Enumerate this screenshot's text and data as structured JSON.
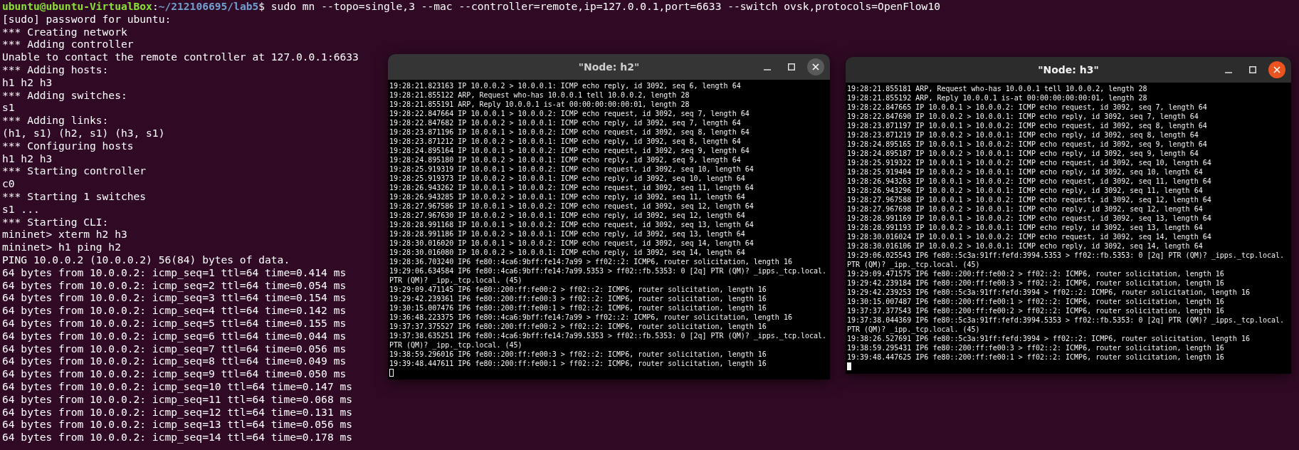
{
  "terminal": {
    "prompt": {
      "user_host": "ubuntu@ubuntu-VirtualBox",
      "separator": ":",
      "path": "~/212106695/lab5",
      "command": "$ sudo mn --topo=single,3 --mac --controller=remote,ip=127.0.0.1,port=6633 --switch ovsk,protocols=OpenFlow10"
    },
    "lines": [
      "[sudo] password for ubuntu:",
      "*** Creating network",
      "*** Adding controller",
      "Unable to contact the remote controller at 127.0.0.1:6633",
      "*** Adding hosts:",
      "h1 h2 h3",
      "*** Adding switches:",
      "s1",
      "*** Adding links:",
      "(h1, s1) (h2, s1) (h3, s1)",
      "*** Configuring hosts",
      "h1 h2 h3",
      "*** Starting controller",
      "c0",
      "*** Starting 1 switches",
      "s1 ...",
      "*** Starting CLI:",
      "mininet> xterm h2 h3",
      "mininet> h1 ping h2",
      "PING 10.0.0.2 (10.0.0.2) 56(84) bytes of data.",
      "64 bytes from 10.0.0.2: icmp_seq=1 ttl=64 time=0.414 ms",
      "64 bytes from 10.0.0.2: icmp_seq=2 ttl=64 time=0.054 ms",
      "64 bytes from 10.0.0.2: icmp_seq=3 ttl=64 time=0.154 ms",
      "64 bytes from 10.0.0.2: icmp_seq=4 ttl=64 time=0.142 ms",
      "64 bytes from 10.0.0.2: icmp_seq=5 ttl=64 time=0.155 ms",
      "64 bytes from 10.0.0.2: icmp_seq=6 ttl=64 time=0.044 ms",
      "64 bytes from 10.0.0.2: icmp_seq=7 ttl=64 time=0.056 ms",
      "64 bytes from 10.0.0.2: icmp_seq=8 ttl=64 time=0.049 ms",
      "64 bytes from 10.0.0.2: icmp_seq=9 ttl=64 time=0.050 ms",
      "64 bytes from 10.0.0.2: icmp_seq=10 ttl=64 time=0.147 ms",
      "64 bytes from 10.0.0.2: icmp_seq=11 ttl=64 time=0.068 ms",
      "64 bytes from 10.0.0.2: icmp_seq=12 ttl=64 time=0.131 ms",
      "64 bytes from 10.0.0.2: icmp_seq=13 ttl=64 time=0.056 ms",
      "64 bytes from 10.0.0.2: icmp_seq=14 ttl=64 time=0.178 ms"
    ]
  },
  "windows": [
    {
      "title": "\"Node: h2\"",
      "focused": false,
      "lines": [
        "19:28:21.823163 IP 10.0.0.2 > 10.0.0.1: ICMP echo reply, id 3092, seq 6, length 64",
        "19:28:21.855122 ARP, Request who-has 10.0.0.1 tell 10.0.0.2, length 28",
        "19:28:21.855191 ARP, Reply 10.0.0.1 is-at 00:00:00:00:00:01, length 28",
        "19:28:22.847664 IP 10.0.0.1 > 10.0.0.2: ICMP echo request, id 3092, seq 7, length 64",
        "19:28:22.847682 IP 10.0.0.2 > 10.0.0.1: ICMP echo reply, id 3092, seq 7, length 64",
        "19:28:23.871196 IP 10.0.0.1 > 10.0.0.2: ICMP echo request, id 3092, seq 8, length 64",
        "19:28:23.871212 IP 10.0.0.2 > 10.0.0.1: ICMP echo reply, id 3092, seq 8, length 64",
        "19:28:24.895164 IP 10.0.0.1 > 10.0.0.2: ICMP echo request, id 3092, seq 9, length 64",
        "19:28:24.895180 IP 10.0.0.2 > 10.0.0.1: ICMP echo reply, id 3092, seq 9, length 64",
        "19:28:25.919319 IP 10.0.0.1 > 10.0.0.2: ICMP echo request, id 3092, seq 10, length 64",
        "19:28:25.919373 IP 10.0.0.2 > 10.0.0.1: ICMP echo reply, id 3092, seq 10, length 64",
        "19:28:26.943262 IP 10.0.0.1 > 10.0.0.2: ICMP echo request, id 3092, seq 11, length 64",
        "19:28:26.943285 IP 10.0.0.2 > 10.0.0.1: ICMP echo reply, id 3092, seq 11, length 64",
        "19:28:27.967586 IP 10.0.0.1 > 10.0.0.2: ICMP echo request, id 3092, seq 12, length 64",
        "19:28:27.967630 IP 10.0.0.2 > 10.0.0.1: ICMP echo reply, id 3092, seq 12, length 64",
        "19:28:28.991168 IP 10.0.0.1 > 10.0.0.2: ICMP echo request, id 3092, seq 13, length 64",
        "19:28:28.991186 IP 10.0.0.2 > 10.0.0.1: ICMP echo reply, id 3092, seq 13, length 64",
        "19:28:30.016020 IP 10.0.0.1 > 10.0.0.2: ICMP echo request, id 3092, seq 14, length 64",
        "19:28:30.016080 IP 10.0.0.2 > 10.0.0.1: ICMP echo reply, id 3092, seq 14, length 64",
        "19:28:36.703240 IP6 fe80::4ca6:9bff:fe14:7a99 > ff02::2: ICMP6, router solicitation, length 16",
        "19:29:06.634584 IP6 fe80::4ca6:9bff:fe14:7a99.5353 > ff02::fb.5353: 0 [2q] PTR (QM)? _ipps._tcp.local.",
        "PTR (QM)? _ipp._tcp.local. (45)",
        "19:29:09.471145 IP6 fe80::200:ff:fe00:2 > ff02::2: ICMP6, router solicitation, length 16",
        "19:29:42.239361 IP6 fe80::200:ff:fe00:3 > ff02::2: ICMP6, router solicitation, length 16",
        "19:30:15.007476 IP6 fe80::200:ff:fe00:1 > ff02::2: ICMP6, router solicitation, length 16",
        "19:36:48.223375 IP6 fe80::4ca6:9bff:fe14:7a99 > ff02::2: ICMP6, router solicitation, length 16",
        "19:37:37.375527 IP6 fe80::200:ff:fe00:2 > ff02::2: ICMP6, router solicitation, length 16",
        "19:37:38.635251 IP6 fe80::4ca6:9bff:fe14:7a99.5353 > ff02::fb.5353: 0 [2q] PTR (QM)? _ipps._tcp.local.",
        "PTR (QM)? _ipp._tcp.local. (45)",
        "19:38:59.296016 IP6 fe80::200:ff:fe00:3 > ff02::2: ICMP6, router solicitation, length 16",
        "19:39:48.447611 IP6 fe80::200:ff:fe00:1 > ff02::2: ICMP6, router solicitation, length 16"
      ]
    },
    {
      "title": "\"Node: h3\"",
      "focused": true,
      "lines": [
        "19:28:21.855181 ARP, Request who-has 10.0.0.1 tell 10.0.0.2, length 28",
        "19:28:21.855192 ARP, Reply 10.0.0.1 is-at 00:00:00:00:00:01, length 28",
        "19:28:22.847665 IP 10.0.0.1 > 10.0.0.2: ICMP echo request, id 3092, seq 7, length 64",
        "19:28:22.847690 IP 10.0.0.2 > 10.0.0.1: ICMP echo reply, id 3092, seq 7, length 64",
        "19:28:23.871197 IP 10.0.0.1 > 10.0.0.2: ICMP echo request, id 3092, seq 8, length 64",
        "19:28:23.871219 IP 10.0.0.2 > 10.0.0.1: ICMP echo reply, id 3092, seq 8, length 64",
        "19:28:24.895165 IP 10.0.0.1 > 10.0.0.2: ICMP echo request, id 3092, seq 9, length 64",
        "19:28:24.895187 IP 10.0.0.2 > 10.0.0.1: ICMP echo reply, id 3092, seq 9, length 64",
        "19:28:25.919322 IP 10.0.0.1 > 10.0.0.2: ICMP echo request, id 3092, seq 10, length 64",
        "19:28:25.919404 IP 10.0.0.2 > 10.0.0.1: ICMP echo reply, id 3092, seq 10, length 64",
        "19:28:26.943263 IP 10.0.0.1 > 10.0.0.2: ICMP echo request, id 3092, seq 11, length 64",
        "19:28:26.943296 IP 10.0.0.2 > 10.0.0.1: ICMP echo reply, id 3092, seq 11, length 64",
        "19:28:27.967588 IP 10.0.0.1 > 10.0.0.2: ICMP echo request, id 3092, seq 12, length 64",
        "19:28:27.967698 IP 10.0.0.2 > 10.0.0.1: ICMP echo reply, id 3092, seq 12, length 64",
        "19:28:28.991169 IP 10.0.0.1 > 10.0.0.2: ICMP echo request, id 3092, seq 13, length 64",
        "19:28:28.991193 IP 10.0.0.2 > 10.0.0.1: ICMP echo reply, id 3092, seq 13, length 64",
        "19:28:30.016024 IP 10.0.0.1 > 10.0.0.2: ICMP echo request, id 3092, seq 14, length 64",
        "19:28:30.016106 IP 10.0.0.2 > 10.0.0.1: ICMP echo reply, id 3092, seq 14, length 64",
        "19:29:06.025543 IP6 fe80::5c3a:91ff:fefd:3994.5353 > ff02::fb.5353: 0 [2q] PTR (QM)? _ipps._tcp.local.",
        "PTR (QM)? _ipp._tcp.local. (45)",
        "19:29:09.471575 IP6 fe80::200:ff:fe00:2 > ff02::2: ICMP6, router solicitation, length 16",
        "19:29:42.239184 IP6 fe80::200:ff:fe00:3 > ff02::2: ICMP6, router solicitation, length 16",
        "19:29:42.239253 IP6 fe80::5c3a:91ff:fefd:3994 > ff02::2: ICMP6, router solicitation, length 16",
        "19:30:15.007487 IP6 fe80::200:ff:fe00:1 > ff02::2: ICMP6, router solicitation, length 16",
        "19:37:37.377543 IP6 fe80::200:ff:fe00:2 > ff02::2: ICMP6, router solicitation, length 16",
        "19:37:38.044369 IP6 fe80::5c3a:91ff:fefd:3994.5353 > ff02::fb.5353: 0 [2q] PTR (QM)? _ipps._tcp.local.",
        "PTR (QM)? _ipp._tcp.local. (45)",
        "19:38:26.527691 IP6 fe80::5c3a:91ff:fefd:3994 > ff02::2: ICMP6, router solicitation, length 16",
        "19:38:59.295431 IP6 fe80::200:ff:fe00:3 > ff02::2: ICMP6, router solicitation, length 16",
        "19:39:48.447625 IP6 fe80::200:ff:fe00:1 > ff02::2: ICMP6, router solicitation, length 16"
      ]
    }
  ]
}
